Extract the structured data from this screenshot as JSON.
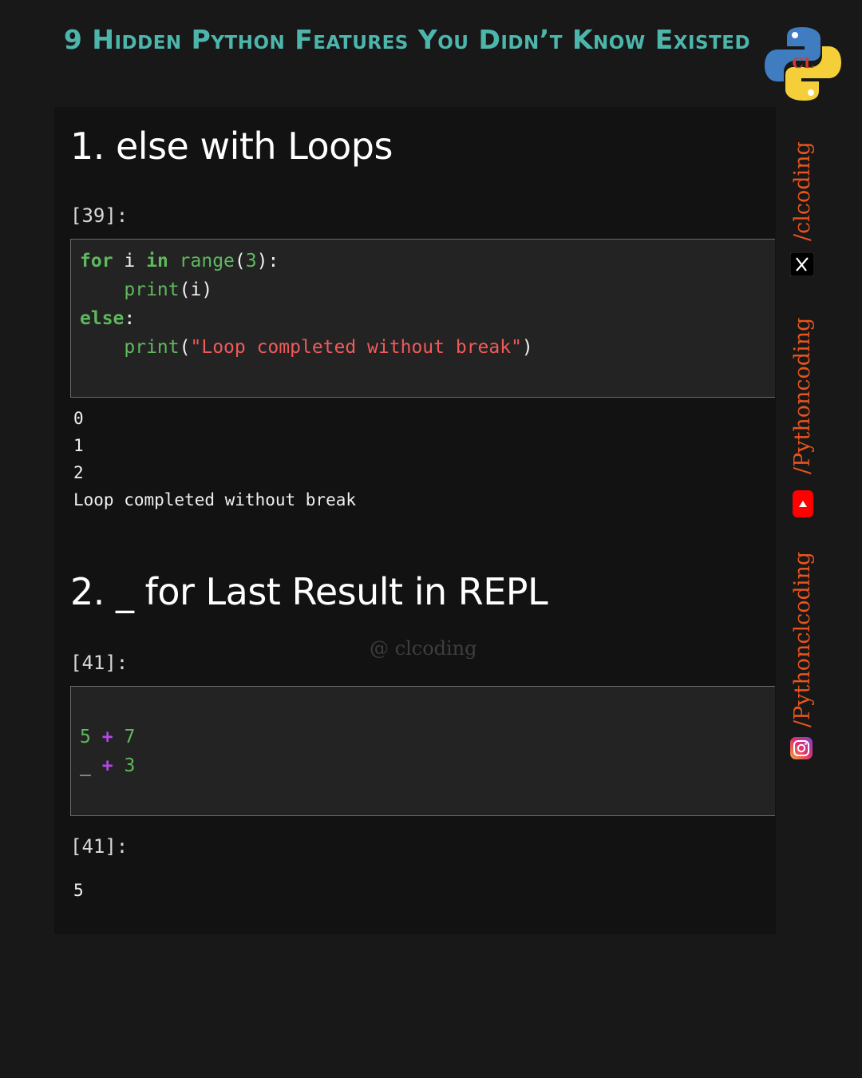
{
  "header": {
    "title": "9 Hidden Python Features You Didn’t Know Existed"
  },
  "sections": [
    {
      "heading": "1. else with Loops",
      "prompt": "[39]:",
      "code_lines": [
        [
          "for",
          " i ",
          "in",
          " ",
          "range",
          "(",
          "3",
          "):"
        ],
        [
          "    ",
          "print",
          "(i)"
        ],
        [
          "else",
          ":"
        ],
        [
          "    ",
          "print",
          "(",
          "\"Loop completed without break\"",
          ")"
        ]
      ],
      "output": [
        "0",
        "1",
        "2",
        "Loop completed without break"
      ]
    },
    {
      "heading": "2. _ for Last Result in REPL",
      "prompt": "[41]:",
      "code_lines": [
        [
          "5",
          " ",
          "+",
          " ",
          "7"
        ],
        [
          "_",
          " ",
          "+",
          " ",
          "3"
        ]
      ],
      "result_prompt": "[41]:",
      "output": [
        "5"
      ]
    }
  ],
  "watermark": "@ clcoding",
  "social": {
    "x_handle": "/clcoding",
    "youtube_handle": "/Pythoncoding",
    "instagram_handle": "/Pythonclcoding"
  },
  "colors": {
    "title": "#4db6ac",
    "keyword": "#5fb85f",
    "string": "#f05a5a",
    "operator": "#b347e6",
    "handle": "#e8541e"
  }
}
